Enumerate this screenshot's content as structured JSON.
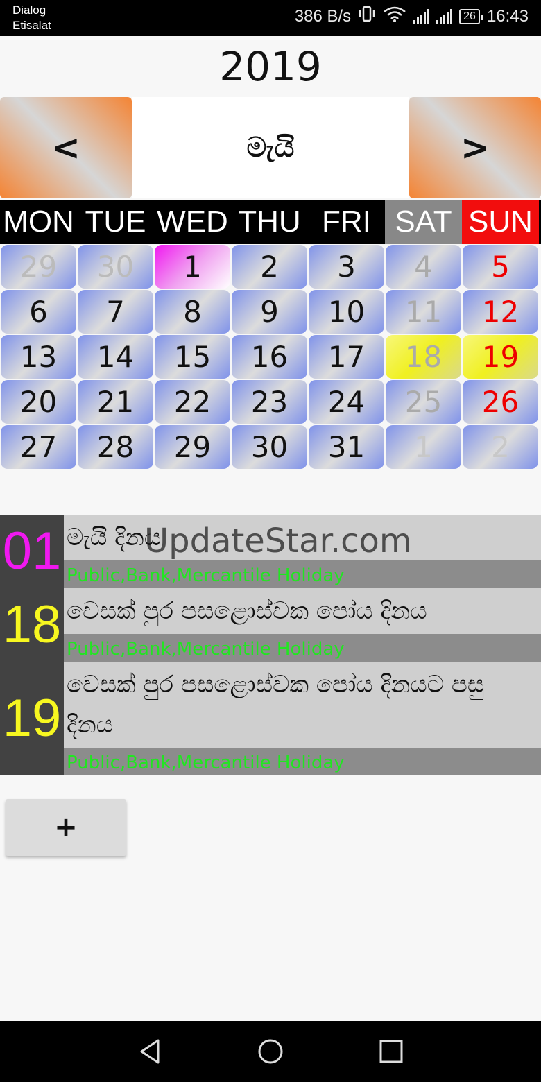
{
  "status": {
    "carrier_line1": "Dialog",
    "carrier_line2": "Etisalat",
    "net_speed": "386 B/s",
    "battery": "26",
    "time": "16:43"
  },
  "calendar": {
    "year": "2019",
    "month": "මැයි",
    "prev_label": "<",
    "next_label": ">",
    "weekdays": [
      "MON",
      "TUE",
      "WED",
      "THU",
      "FRI",
      "SAT",
      "SUN"
    ],
    "days": [
      [
        "29",
        "30",
        "1",
        "2",
        "3",
        "4",
        "5"
      ],
      [
        "6",
        "7",
        "8",
        "9",
        "10",
        "11",
        "12"
      ],
      [
        "13",
        "14",
        "15",
        "16",
        "17",
        "18",
        "19"
      ],
      [
        "20",
        "21",
        "22",
        "23",
        "24",
        "25",
        "26"
      ],
      [
        "27",
        "28",
        "29",
        "30",
        "31",
        "1",
        "2"
      ]
    ],
    "today": "1",
    "highlight_days": [
      "18",
      "19"
    ]
  },
  "events": [
    {
      "day": "01",
      "color": "#f018f0",
      "title": "මැයි දිනය",
      "subtitle": "Public,Bank,Mercantile Holiday"
    },
    {
      "day": "18",
      "color": "#f7f720",
      "title": "වෙසක් පුර පසළොස්වක පෝය දිනය",
      "subtitle": "Public,Bank,Mercantile Holiday"
    },
    {
      "day": "19",
      "color": "#f7f720",
      "title": "වෙසක් පුර පසළොස්වක පෝය දිනයට පසු දිනය",
      "subtitle": "Public,Bank,Mercantile Holiday"
    }
  ],
  "watermark": "UpdateStar.com",
  "add_button_label": "+",
  "colors": {
    "weekday_bar": "#000000",
    "saturday": "#888888",
    "sunday": "#f20d0d",
    "subtitle_text": "#21e621"
  }
}
